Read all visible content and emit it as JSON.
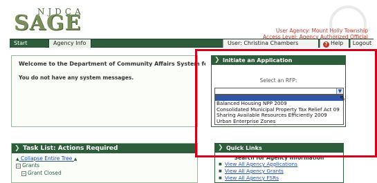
{
  "header": {
    "logo_top": "NJDCA",
    "logo_main": "SAGE",
    "agency_line": "User Agency: Mount Holly Township",
    "access_line": "Access Level: Agency Authorized Official"
  },
  "nav": {
    "tabs": [
      {
        "label": "Start Menu"
      },
      {
        "label": "Agency Info"
      }
    ],
    "user": "User: Christina Chambers",
    "help": "Help",
    "logout": "Logout"
  },
  "welcome": {
    "title": "Welcome to the Department of Community Affairs System for Administering Grants Electronically.",
    "message": "You do not have any system messages."
  },
  "initiate": {
    "title": "Initiate an Application",
    "select_label": "Select an RFP:",
    "selected_value": "",
    "options": [
      "Balanced Housing NPP 2009",
      "Consolidated Municipal Property Tax Relief Act 09",
      "Sharing Available Resources Efficiently 2009",
      "Urban Enterprise Zones"
    ]
  },
  "tasklist": {
    "title": "Task List: Actions Required",
    "collapse": "Collapse Entire Tree",
    "items": [
      {
        "label": "Grants"
      },
      {
        "label": "Grant Closed"
      }
    ]
  },
  "quicklinks": {
    "title": "Quick Links",
    "subtitle": "Search for Agency Information",
    "links": [
      "View All Agency Applications",
      "View All Agency Grants",
      "View All Agency FSRs"
    ]
  },
  "colors": {
    "nav_green": "#2e5d3c",
    "link_blue": "#1f4f9c",
    "highlight_red": "#d0001b",
    "selection_blue": "#2f57a6"
  }
}
